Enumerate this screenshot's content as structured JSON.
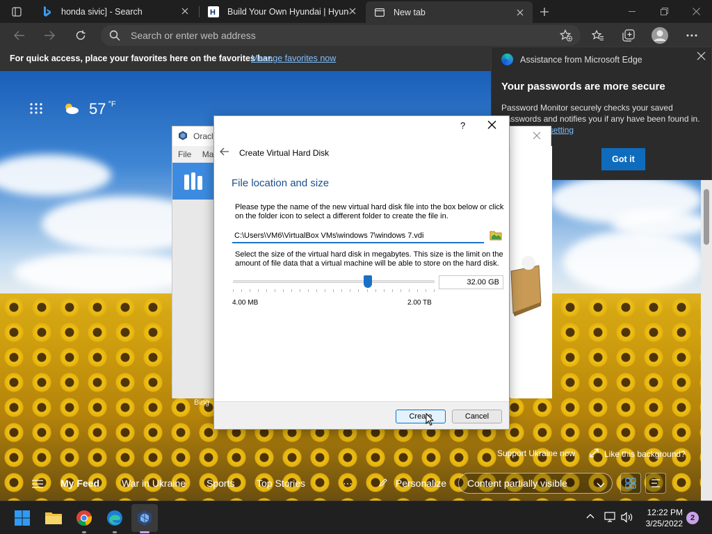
{
  "browser": {
    "tabs": [
      {
        "title": "honda sivic] - Search"
      },
      {
        "title": "Build Your Own Hyundai | Hyund"
      },
      {
        "title": "New tab"
      }
    ],
    "address_placeholder": "Search or enter web address",
    "favorites_bar": {
      "message": "For quick access, place your favorites here on the favorites bar.",
      "link": "Manage favorites now"
    }
  },
  "edge_popup": {
    "header": "Assistance from Microsoft Edge",
    "title": "Your passwords are more secure",
    "body": "Password Monitor securely checks your saved passwords and notifies you if any have been found in",
    "body_end": ".",
    "link": "Manage this setting",
    "button": "Got it"
  },
  "weather": {
    "temp": "57",
    "unit": "°F"
  },
  "vbox_manager": {
    "title": "Oracle",
    "menu_file": "File",
    "menu_machine": "Ma"
  },
  "dialog": {
    "help": "?",
    "title": "Create Virtual Hard Disk",
    "section": "File location and size",
    "desc1": "Please type the name of the new virtual hard disk file into the box below or click on the folder icon to select a different folder to create the file in.",
    "path": "C:\\Users\\VM6\\VirtualBox VMs\\windows 7\\windows 7.vdi",
    "desc2": "Select the size of the virtual hard disk in megabytes. This size is the limit on the amount of file data that a virtual machine will be able to store on the hard disk.",
    "size_value": "32.00 GB",
    "min_label": "4.00 MB",
    "max_label": "2.00 TB",
    "create": "Create",
    "cancel": "Cancel"
  },
  "page_footer": {
    "bing": "Bing",
    "support": "Support Ukraine now",
    "like_bg": "Like this background?",
    "feed": [
      "My Feed",
      "War in Ukraine",
      "Sports",
      "Top Stories",
      "⋯",
      "Personalize"
    ],
    "content_visibility": "Content partially visible"
  },
  "taskbar": {
    "time": "12:22 PM",
    "date": "3/25/2022",
    "notifications": "2"
  },
  "colors": {
    "accent": "#0f6cbd",
    "dialog_heading": "#1c4e8a",
    "slider": "#1a6fc4"
  }
}
